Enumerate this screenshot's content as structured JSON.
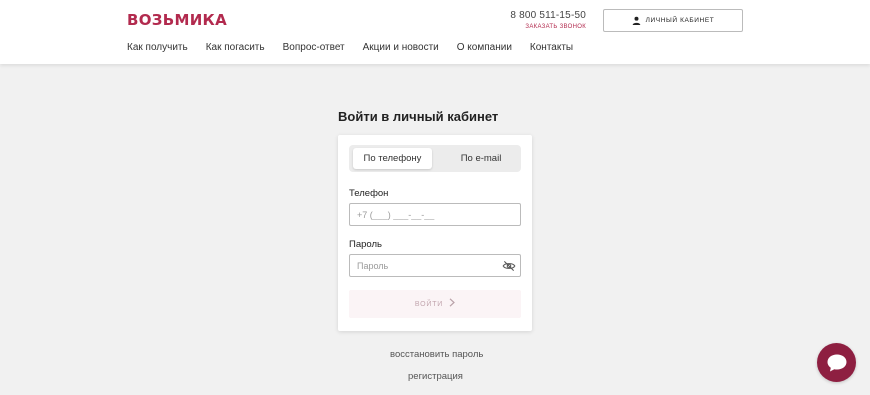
{
  "header": {
    "logo": "ВОЗЬМИКА",
    "phone": "8 800 511-15-50",
    "callback_label": "ЗАКАЗАТЬ ЗВОНОК",
    "cabinet_label": "ЛИЧНЫЙ КАБИНЕТ",
    "nav": [
      {
        "label": "Как получить"
      },
      {
        "label": "Как погасить"
      },
      {
        "label": "Вопрос-ответ"
      },
      {
        "label": "Акции и новости"
      },
      {
        "label": "О компании"
      },
      {
        "label": "Контакты"
      }
    ]
  },
  "login": {
    "title": "Войти в личный кабинет",
    "tabs": [
      {
        "label": "По телефону",
        "active": true
      },
      {
        "label": "По e-mail",
        "active": false
      }
    ],
    "phone_label": "Телефон",
    "phone_placeholder": "+7 (___) ___-__-__",
    "password_label": "Пароль",
    "password_placeholder": "Пароль",
    "submit_label": "ВОЙТИ"
  },
  "links": {
    "restore": "восстановить пароль",
    "register": "регистрация"
  },
  "icons": {
    "user": "user-icon",
    "eye": "eye-off-icon",
    "chevron": "chevron-right-icon",
    "chat": "chat-icon"
  },
  "colors": {
    "brand": "#b22a4e",
    "chat": "#8e1f41",
    "background": "#f1f1f1"
  }
}
